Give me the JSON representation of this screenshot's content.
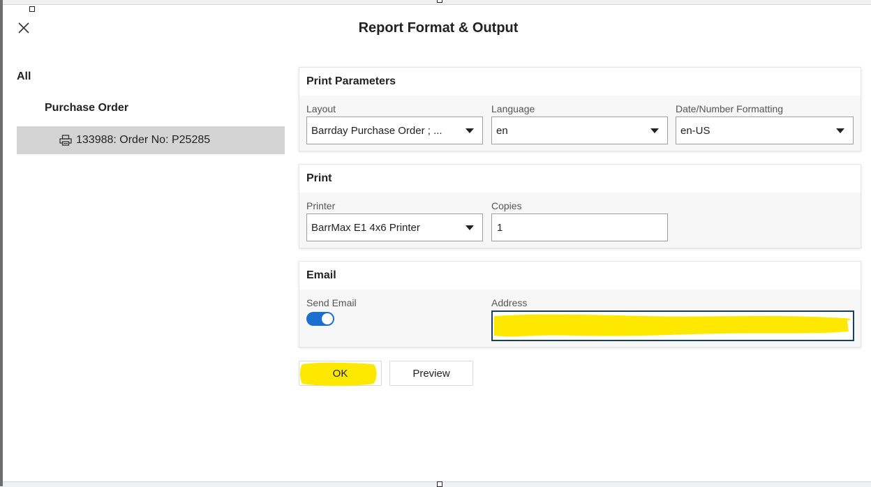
{
  "dialog": {
    "title": "Report Format & Output"
  },
  "tree": {
    "root": "All",
    "group": "Purchase Order",
    "items": [
      {
        "label": "133988: Order No: P25285",
        "icon": "printer-icon",
        "selected": true
      }
    ]
  },
  "print_parameters": {
    "header": "Print Parameters",
    "layout": {
      "label": "Layout",
      "value": "Barrday Purchase Order ; ..."
    },
    "language": {
      "label": "Language",
      "value": "en"
    },
    "formatting": {
      "label": "Date/Number Formatting",
      "value": "en-US"
    }
  },
  "print": {
    "header": "Print",
    "printer": {
      "label": "Printer",
      "value": "BarrMax E1 4x6 Printer"
    },
    "copies": {
      "label": "Copies",
      "value": "1"
    }
  },
  "email": {
    "header": "Email",
    "send_email": {
      "label": "Send Email",
      "enabled": true
    },
    "address": {
      "label": "Address",
      "value": ""
    }
  },
  "buttons": {
    "ok": "OK",
    "preview": "Preview"
  },
  "colors": {
    "toggle_on": "#1a6fd1",
    "highlight": "#ffe800",
    "selected_row": "#d4d4d4",
    "address_border": "#1d3f5e"
  }
}
